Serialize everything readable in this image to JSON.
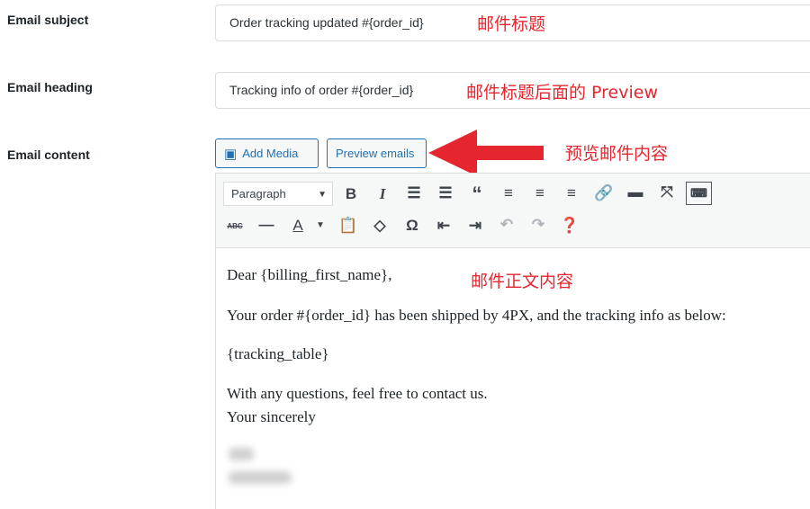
{
  "fields": {
    "subject": {
      "label": "Email subject",
      "value": "Order tracking updated #{order_id}",
      "note": "邮件标题"
    },
    "heading": {
      "label": "Email heading",
      "value": "Tracking info of order #{order_id}",
      "note": "邮件标题后面的 Preview"
    },
    "content": {
      "label": "Email content",
      "note": "预览邮件内容"
    }
  },
  "buttons": {
    "add_media": "Add Media",
    "preview": "Preview emails"
  },
  "toolbar": {
    "format": "Paragraph"
  },
  "body": {
    "note": "邮件正文内容",
    "lines": [
      "Dear {billing_first_name},",
      "Your order #{order_id} has been shipped by 4PX, and the tracking info as below:",
      "{tracking_table}",
      "With any questions, feel free to contact us.",
      "Your sincerely"
    ]
  },
  "colors": {
    "accent": "#2271b1",
    "annotation": "#e6262e"
  }
}
